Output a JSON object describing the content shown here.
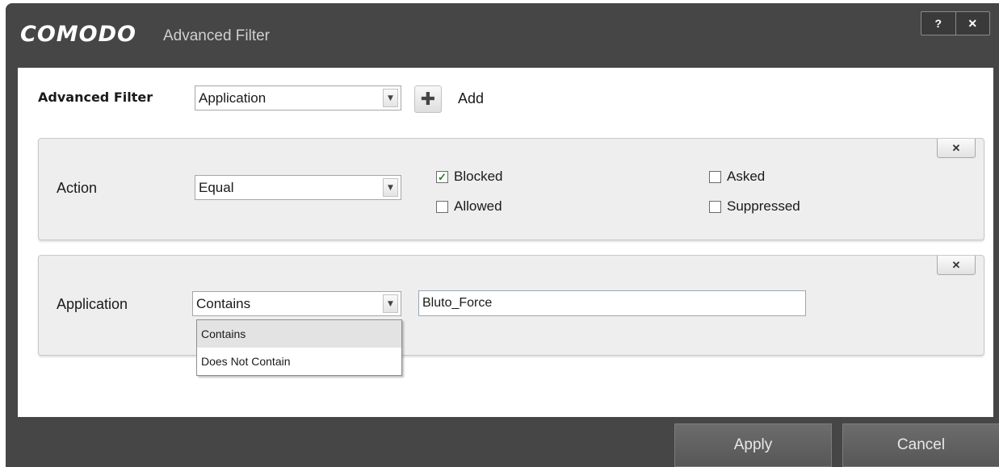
{
  "window": {
    "brand": "COMODO",
    "title": "Advanced Filter",
    "help_label": "?",
    "close_label": "✕"
  },
  "filter": {
    "label": "Advanced Filter",
    "selected": "Application",
    "add_label": "Add"
  },
  "action_row": {
    "label": "Action",
    "operator": "Equal",
    "options": [
      {
        "label": "Blocked",
        "checked": true
      },
      {
        "label": "Asked",
        "checked": false
      },
      {
        "label": "Allowed",
        "checked": false
      },
      {
        "label": "Suppressed",
        "checked": false
      }
    ]
  },
  "application_row": {
    "label": "Application",
    "operator": "Contains",
    "value": "Bluto_Force",
    "dropdown_options": [
      "Contains",
      "Does Not Contain"
    ]
  },
  "footer": {
    "apply_label": "Apply",
    "cancel_label": "Cancel"
  },
  "colors": {
    "chrome": "#464646",
    "panel": "#eeeeee",
    "check": "#2a7a2a"
  }
}
